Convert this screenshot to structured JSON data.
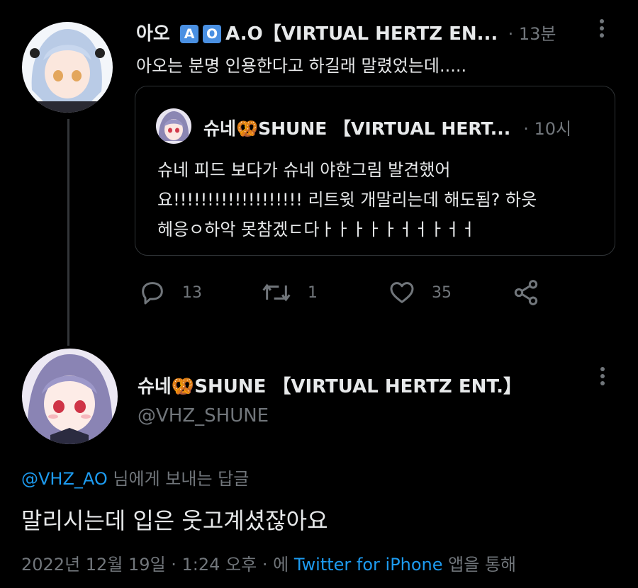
{
  "top_tweet": {
    "display_name": "아오",
    "badge_a": "A",
    "badge_o": "O",
    "name_rest": "A.O【VIRTUAL HERTZ EN...",
    "time": "· 13분",
    "text": "아오는 분명 인용한다고 하길래 말렸었는데.....",
    "quote": {
      "display_name": "슈네🥨SHUNE 【VIRTUAL HERT...",
      "time": "· 10시",
      "line1": "슈네 피드 보다가 슈네 야한그림 발견했어",
      "line2": "요!!!!!!!!!!!!!!!!!!! 리트윗 개말리는데 해도됨? 하읏",
      "line3": "헤응ㅇ하악 못참겠ㄷ다ㅏㅏㅏㅏㅏㅓㅓㅏㅓㅓ"
    },
    "actions": {
      "reply_count": "13",
      "retweet_count": "1",
      "like_count": "35"
    }
  },
  "main_tweet": {
    "display_name": "슈네🥨SHUNE 【VIRTUAL HERTZ ENT.】",
    "handle": "@VHZ_SHUNE",
    "reply_to_handle": "@VHZ_AO",
    "reply_to_suffix": " 님에게 보내는 답글",
    "text": "말리시는데 입은 웃고계셨잖아요",
    "meta_date": "2022년 12월 19일 · 1:24 오후 · 에 ",
    "meta_source": "Twitter for iPhone",
    "meta_suffix": " 앱을 통해"
  },
  "colors": {
    "accent": "#1d9bf0",
    "muted": "#71767b",
    "text": "#e7e9ea",
    "background": "#000000"
  }
}
